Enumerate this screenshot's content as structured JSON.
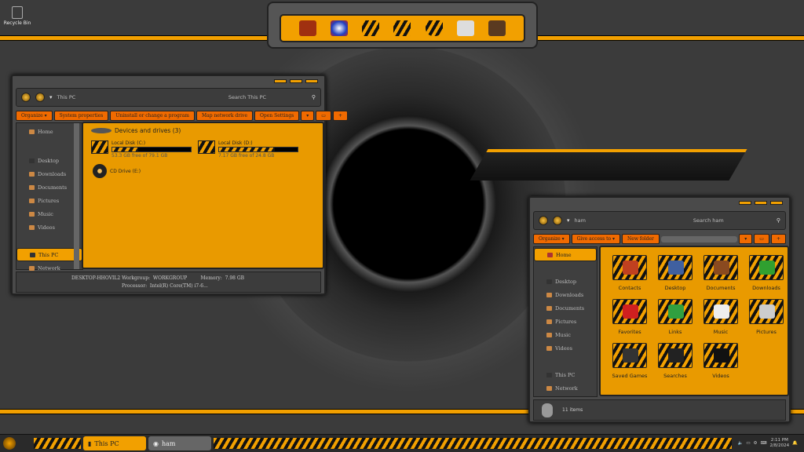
{
  "desktop": {
    "recycle_bin": "Recycle Bin"
  },
  "dock": {
    "icons": [
      "computer-icon",
      "browser-icon",
      "folder-icon",
      "documents-icon",
      "shield-icon",
      "control-panel-icon",
      "recycle-icon"
    ]
  },
  "window_this_pc": {
    "address": "This PC",
    "search_placeholder": "Search This PC",
    "toolbar": [
      "Organize ▾",
      "System properties",
      "Uninstall or change a program",
      "Map network drive",
      "Open Settings"
    ],
    "sidebar": [
      "Home",
      "Desktop",
      "Downloads",
      "Documents",
      "Pictures",
      "Music",
      "Videos",
      "This PC",
      "Network"
    ],
    "group_title": "Devices and drives (3)",
    "drives": [
      {
        "name": "Local Disk (C:)",
        "free": "53.3 GB free of 79.1 GB",
        "used_fraction": 0.33
      },
      {
        "name": "Local Disk (D:)",
        "free": "7.17 GB free of 24.8 GB",
        "used_fraction": 0.71
      },
      {
        "name": "CD Drive (E:)"
      }
    ],
    "status": {
      "computer": "DESKTOP-HHOVIL2",
      "workgroup_label": "Workgroup:",
      "workgroup": "WORKGROUP",
      "memory_label": "Memory:",
      "memory": "7.98 GB",
      "processor_label": "Processor:",
      "processor": "Intel(R) Core(TM) i7-6..."
    }
  },
  "window_ham": {
    "address": "ham",
    "search_placeholder": "Search ham",
    "toolbar": [
      "Organize ▾",
      "Give access to ▾",
      "New folder"
    ],
    "sidebar": [
      "Home",
      "Desktop",
      "Downloads",
      "Documents",
      "Pictures",
      "Music",
      "Videos",
      "This PC",
      "Network"
    ],
    "items": [
      "Contacts",
      "Desktop",
      "Documents",
      "Downloads",
      "Favorites",
      "Links",
      "Music",
      "Pictures",
      "Saved Games",
      "Searches",
      "Videos"
    ],
    "status": "11 items"
  },
  "taskbar": {
    "tasks": [
      "This PC",
      "ham"
    ],
    "time": "2:11 PM",
    "date": "2/8/2024"
  },
  "colors": {
    "accent": "#f2a000",
    "button": "#f06a00",
    "frame": "#4a4a4a"
  }
}
